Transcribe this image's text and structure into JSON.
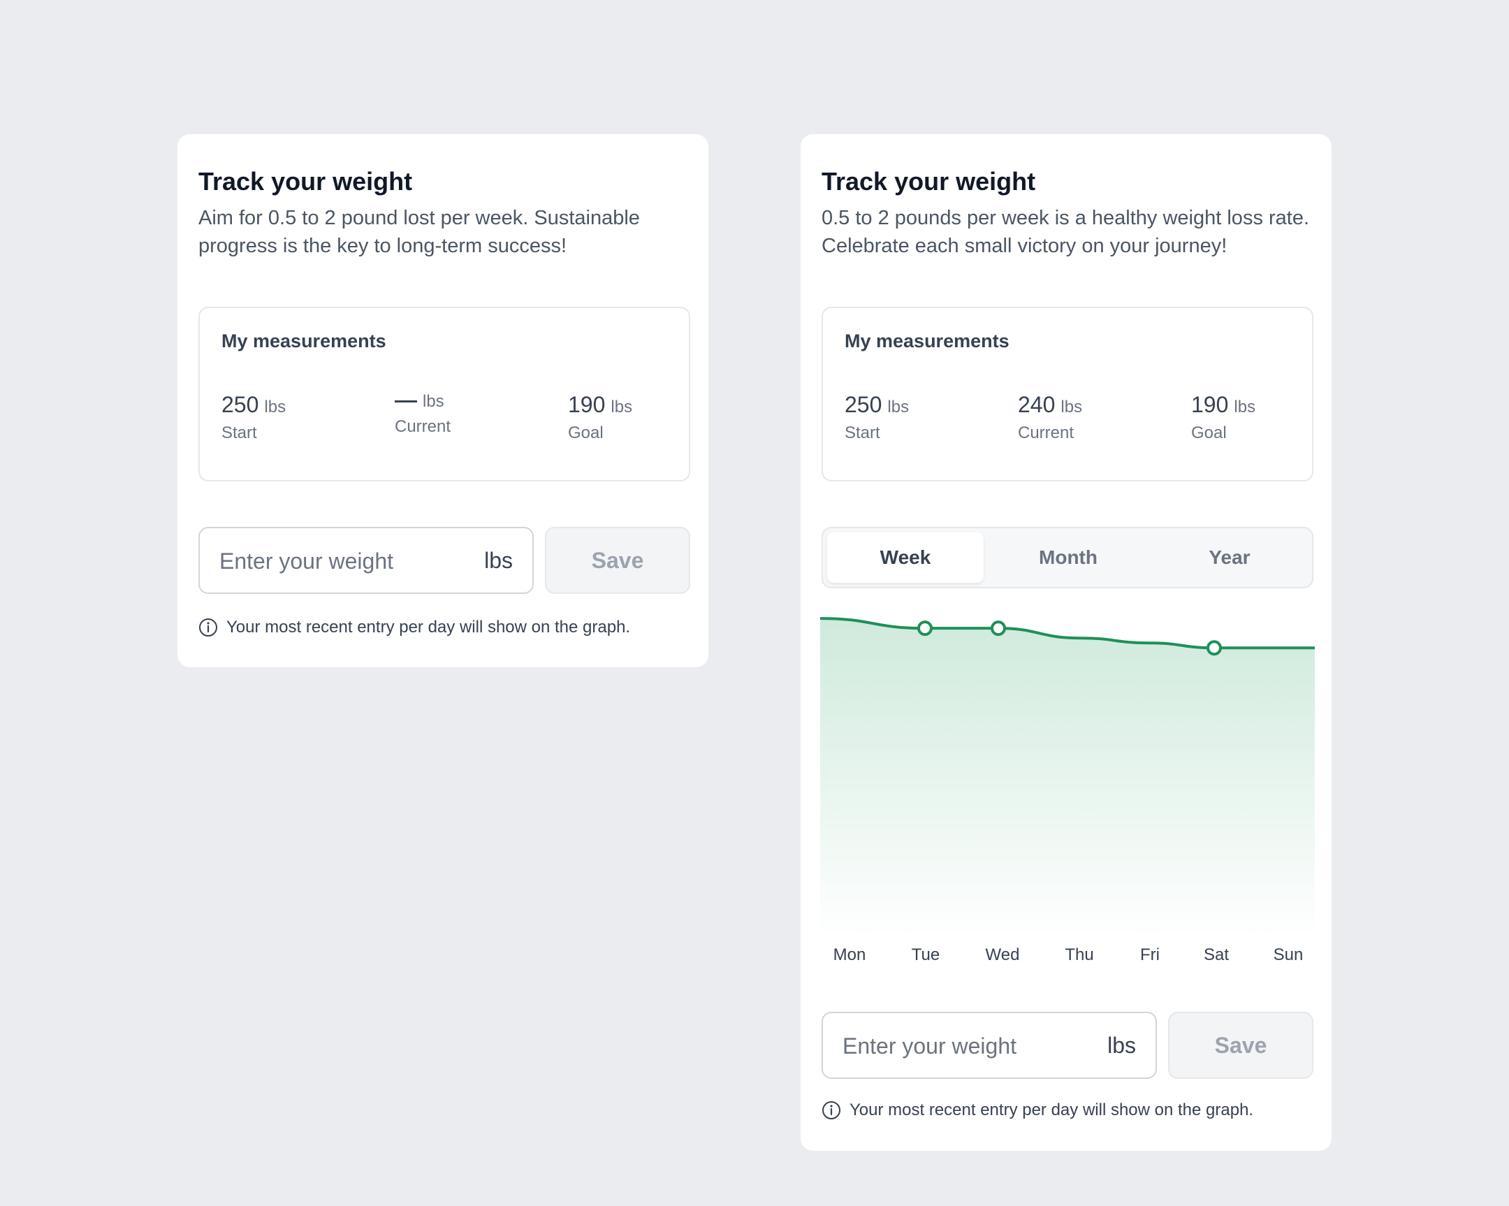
{
  "cards": [
    {
      "title": "Track your weight",
      "description": "Aim for 0.5 to 2 pound lost per week. Sustainable progress is the key to long-term success!",
      "measurements": {
        "title": "My measurements",
        "start": {
          "value": "250",
          "unit": "lbs",
          "label": "Start"
        },
        "current": {
          "value": "",
          "unit": "lbs",
          "label": "Current"
        },
        "goal": {
          "value": "190",
          "unit": "lbs",
          "label": "Goal"
        }
      },
      "input": {
        "placeholder": "Enter your weight",
        "unit": "lbs",
        "value": ""
      },
      "save_label": "Save",
      "info": "Your most recent entry per day will show on the graph."
    },
    {
      "title": "Track your weight",
      "description": "0.5 to 2 pounds per week is a healthy weight loss rate. Celebrate each small victory on your journey!",
      "measurements": {
        "title": "My measurements",
        "start": {
          "value": "250",
          "unit": "lbs",
          "label": "Start"
        },
        "current": {
          "value": "240",
          "unit": "lbs",
          "label": "Current"
        },
        "goal": {
          "value": "190",
          "unit": "lbs",
          "label": "Goal"
        }
      },
      "tabs": [
        {
          "label": "Week",
          "active": true
        },
        {
          "label": "Month",
          "active": false
        },
        {
          "label": "Year",
          "active": false
        }
      ],
      "input": {
        "placeholder": "Enter your weight",
        "unit": "lbs",
        "value": ""
      },
      "save_label": "Save",
      "info": "Your most recent entry per day will show on the graph."
    }
  ],
  "colors": {
    "accent": "#1e9059",
    "area_top": "#cfeadc",
    "area_bottom": "#ffffff"
  },
  "chart_data": {
    "type": "area",
    "categories": [
      "Mon",
      "Tue",
      "Wed",
      "Thu",
      "Fri",
      "Sat",
      "Sun"
    ],
    "values": [
      245,
      243,
      243,
      241,
      240,
      239,
      239
    ],
    "markers": [
      "Tue",
      "Wed",
      "Sat"
    ],
    "ylim": [
      180,
      248
    ],
    "grid": false,
    "legend": "none"
  }
}
